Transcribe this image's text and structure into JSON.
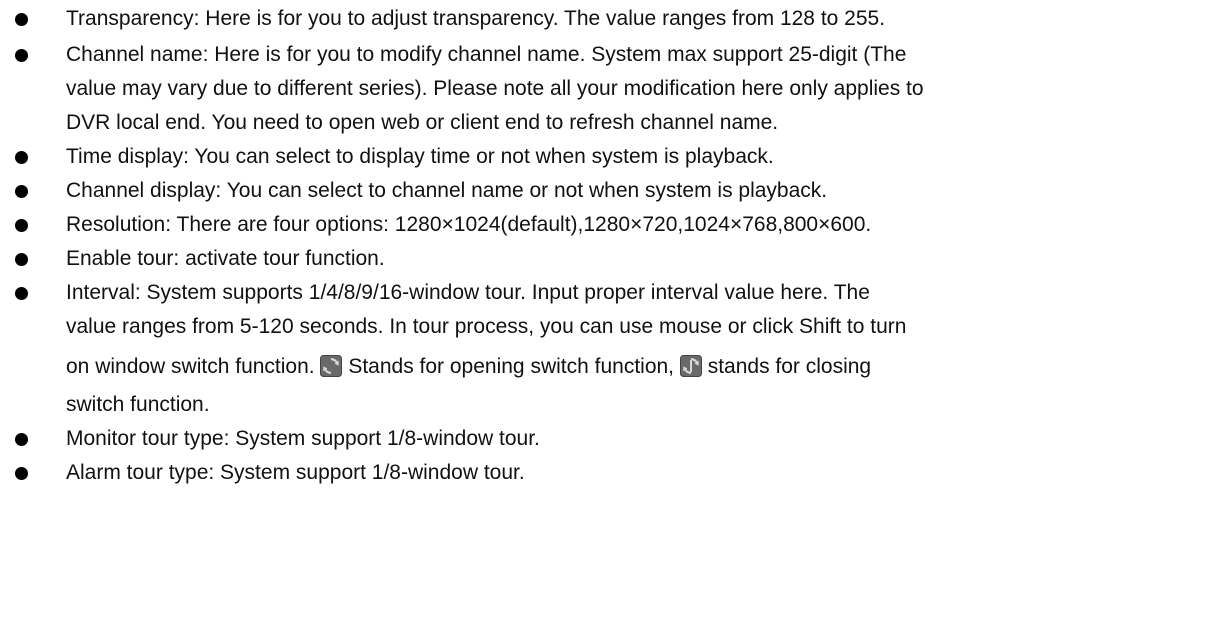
{
  "items": [
    {
      "lines": [
        "Transparency: Here is for you to adjust transparency. The value ranges from 128 to 255."
      ]
    },
    {
      "lines": [
        "Channel name: Here is for you to modify channel name. System max support 25-digit (The",
        "value may vary due to different series). Please note all your modification here only applies to",
        "DVR local end. You need to open web or client end to refresh channel name."
      ]
    },
    {
      "lines": [
        "Time display: You can select to display time or not when system is playback."
      ]
    },
    {
      "lines": [
        "Channel display: You can select to channel name or not when system is playback."
      ]
    },
    {
      "lines": [
        "Resolution: There are four options: 1280×1024(default),1280×720,1024×768,800×600."
      ]
    },
    {
      "lines": [
        "Enable tour: activate tour function."
      ]
    },
    {
      "lines": [
        "Interval: System supports 1/4/8/9/16-window tour. Input proper interval value here. The",
        "value ranges from 5-120 seconds. In tour process, you can use mouse or click Shift to turn"
      ],
      "line3_a": "on window switch function.",
      "line3_b": " Stands for opening switch function,",
      "line3_c": " stands for closing",
      "line4": "switch function.",
      "icon_open": "switch-open-icon",
      "icon_close": "switch-close-icon"
    },
    {
      "lines": [
        "Monitor tour type: System support 1/8-window tour."
      ]
    },
    {
      "lines": [
        "Alarm tour type: System support 1/8-window tour."
      ]
    }
  ]
}
